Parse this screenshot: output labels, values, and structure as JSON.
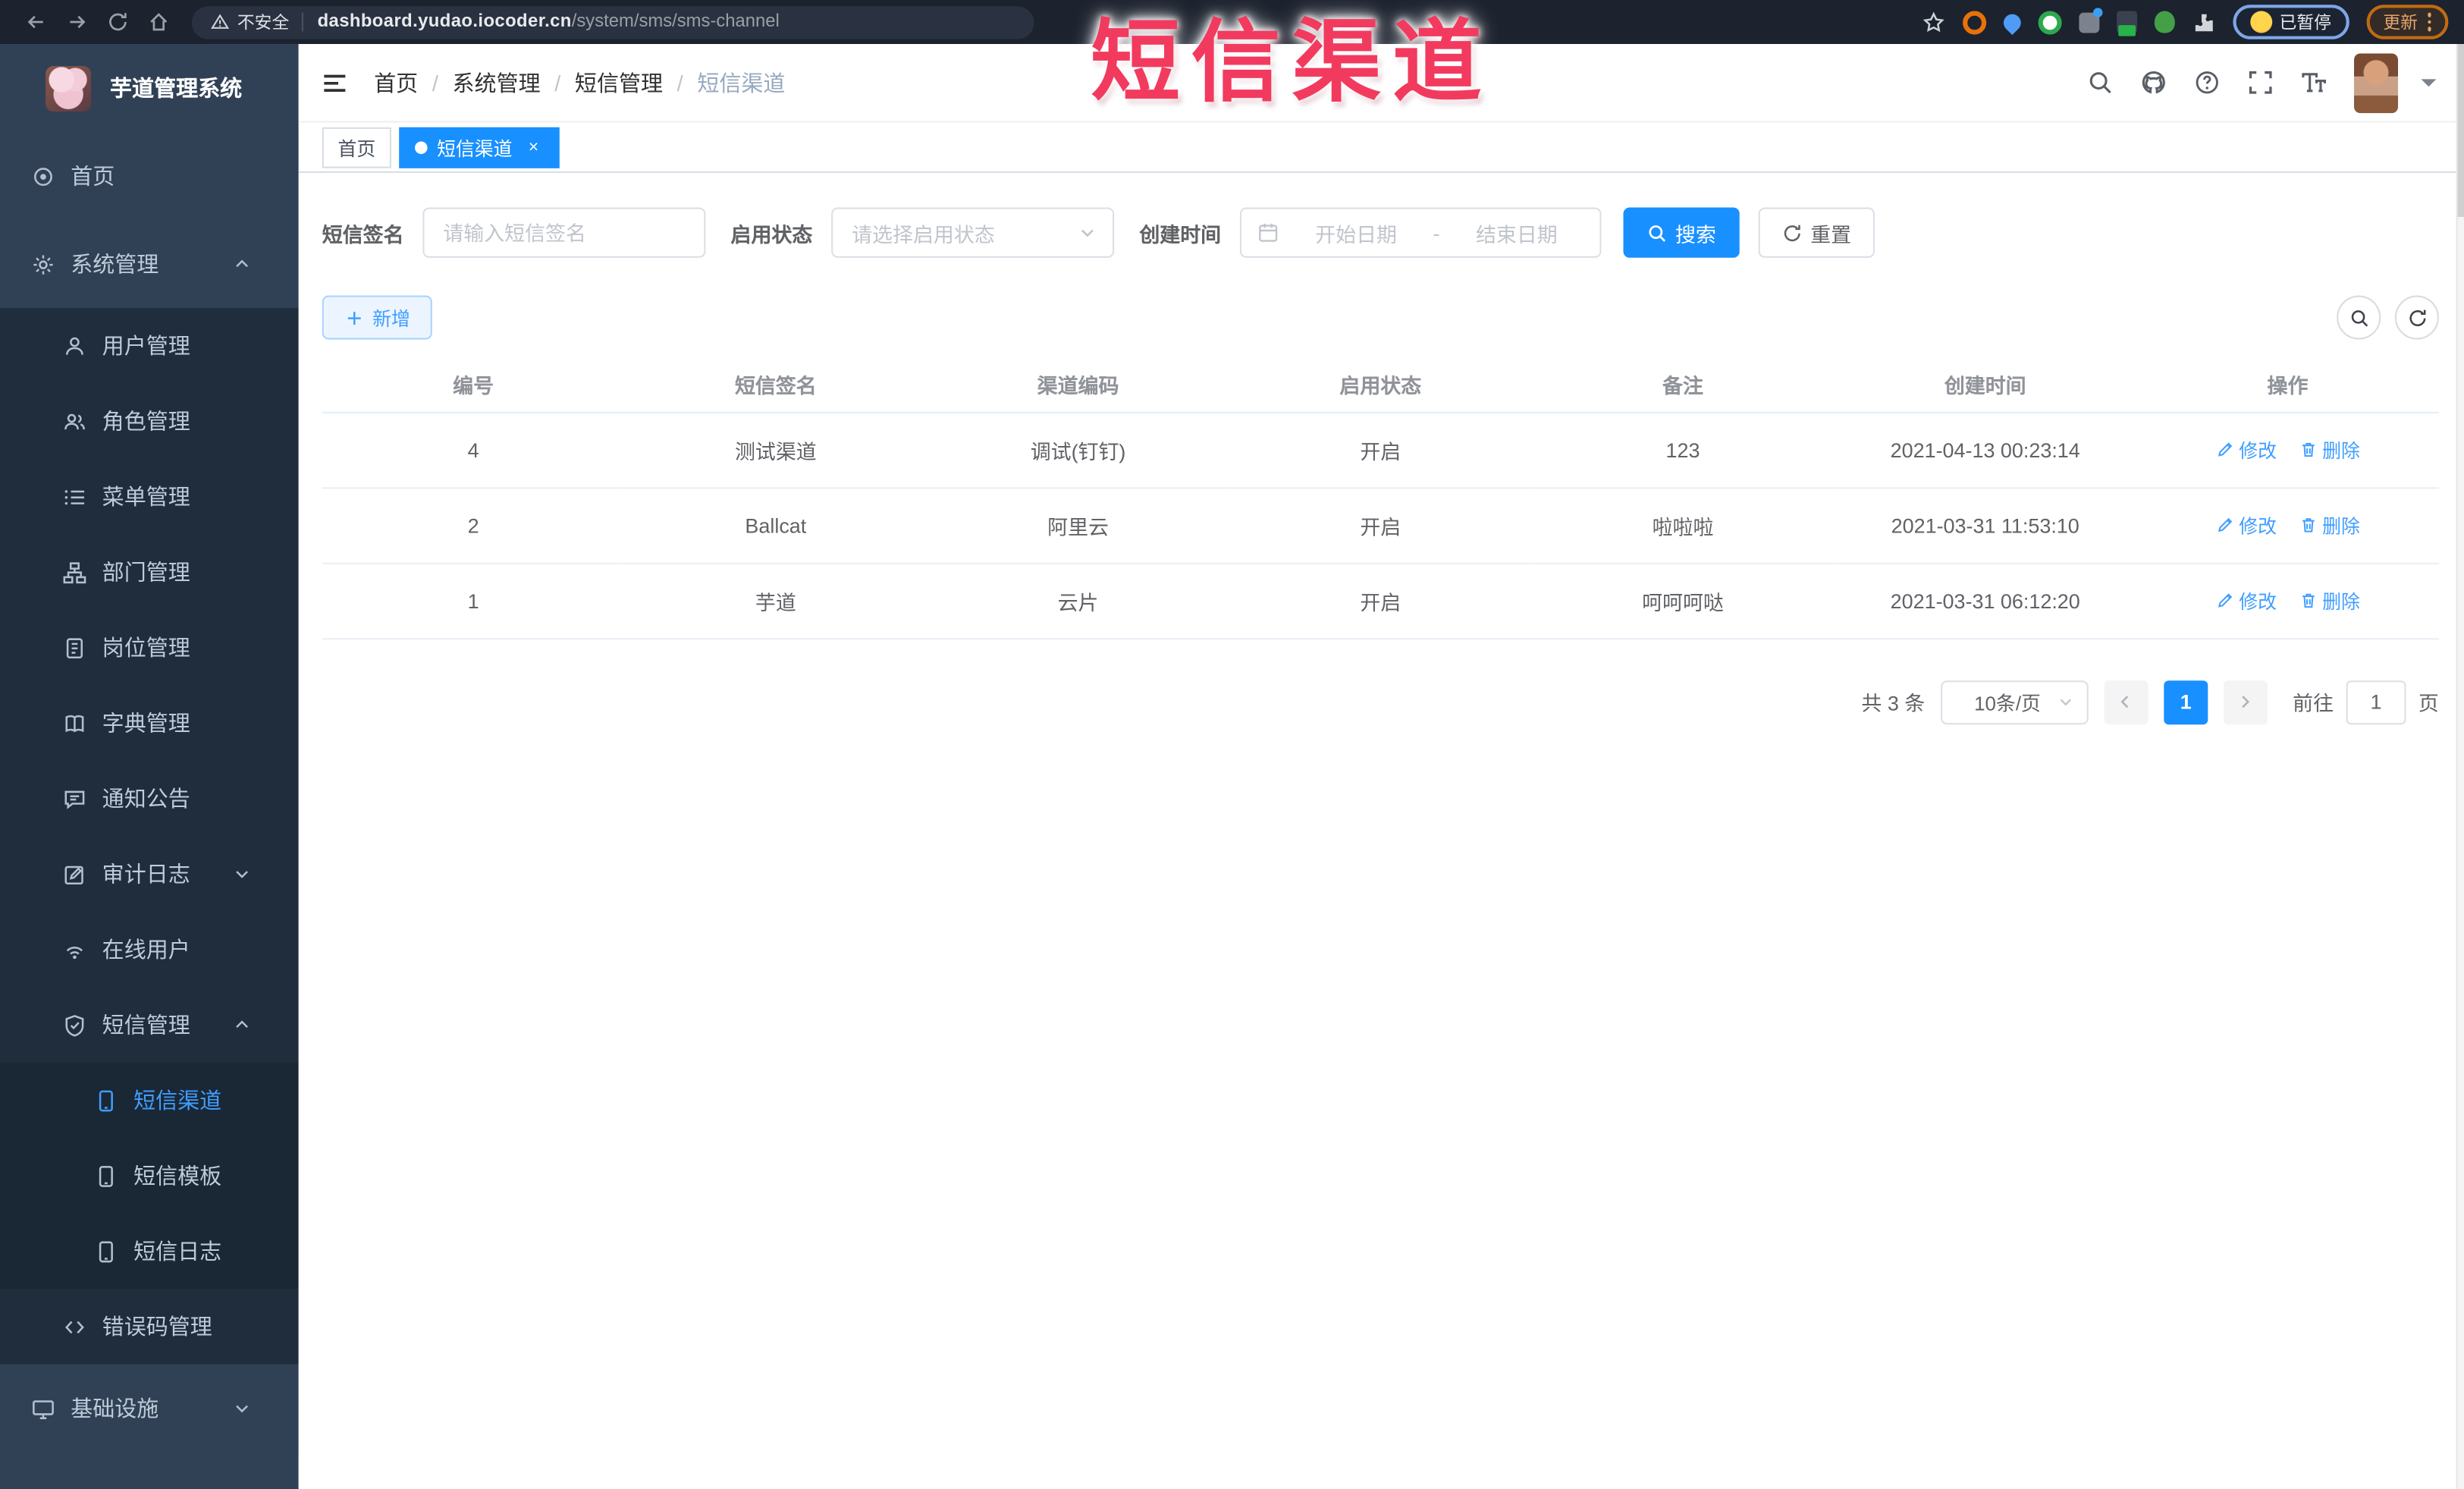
{
  "browser": {
    "security_label": "不安全",
    "url_host": "dashboard.yudao.iocoder.cn",
    "url_path": "/system/sms/sms-channel",
    "paused_label": "已暂停",
    "update_label": "更新"
  },
  "overlay": {
    "annotation": "短信渠道"
  },
  "sidebar": {
    "logo_title": "芋道管理系统",
    "menu": [
      {
        "label": "首页",
        "icon": "dashboard-icon",
        "level": 1
      },
      {
        "label": "系统管理",
        "icon": "gear-icon",
        "level": 1,
        "chevron": "up"
      },
      {
        "label": "用户管理",
        "icon": "user-icon",
        "level": 2
      },
      {
        "label": "角色管理",
        "icon": "users-icon",
        "level": 2
      },
      {
        "label": "菜单管理",
        "icon": "list-icon",
        "level": 2
      },
      {
        "label": "部门管理",
        "icon": "tree-icon",
        "level": 2
      },
      {
        "label": "岗位管理",
        "icon": "badge-icon",
        "level": 2
      },
      {
        "label": "字典管理",
        "icon": "book-icon",
        "level": 2
      },
      {
        "label": "通知公告",
        "icon": "chat-icon",
        "level": 2
      },
      {
        "label": "审计日志",
        "icon": "edit-icon",
        "level": 2,
        "chevron": "down"
      },
      {
        "label": "在线用户",
        "icon": "signal-icon",
        "level": 2
      },
      {
        "label": "短信管理",
        "icon": "shield-icon",
        "level": 2,
        "chevron": "up"
      },
      {
        "label": "短信渠道",
        "icon": "phone-icon",
        "level": 3,
        "active": true
      },
      {
        "label": "短信模板",
        "icon": "phone-icon",
        "level": 3
      },
      {
        "label": "短信日志",
        "icon": "phone-icon",
        "level": 3
      },
      {
        "label": "错误码管理",
        "icon": "code-icon",
        "level": 2
      },
      {
        "label": "基础设施",
        "icon": "monitor-icon",
        "level": 1,
        "chevron": "down"
      }
    ]
  },
  "navbar": {
    "breadcrumb": [
      "首页",
      "系统管理",
      "短信管理",
      "短信渠道"
    ]
  },
  "tabs": [
    {
      "label": "首页",
      "active": false
    },
    {
      "label": "短信渠道",
      "active": true,
      "closable": true
    }
  ],
  "filters": {
    "sign_label": "短信签名",
    "sign_placeholder": "请输入短信签名",
    "status_label": "启用状态",
    "status_placeholder": "请选择启用状态",
    "time_label": "创建时间",
    "start_placeholder": "开始日期",
    "range_separator": "-",
    "end_placeholder": "结束日期",
    "search_label": "搜索",
    "reset_label": "重置"
  },
  "toolbar": {
    "add_label": "新增"
  },
  "table": {
    "columns": [
      "编号",
      "短信签名",
      "渠道编码",
      "启用状态",
      "备注",
      "创建时间",
      "操作"
    ],
    "rows": [
      {
        "id": "4",
        "sign": "测试渠道",
        "code": "调试(钉钉)",
        "status": "开启",
        "remark": "123",
        "created": "2021-04-13 00:23:14"
      },
      {
        "id": "2",
        "sign": "Ballcat",
        "code": "阿里云",
        "status": "开启",
        "remark": "啦啦啦",
        "created": "2021-03-31 11:53:10"
      },
      {
        "id": "1",
        "sign": "芋道",
        "code": "云片",
        "status": "开启",
        "remark": "呵呵呵哒",
        "created": "2021-03-31 06:12:20"
      }
    ],
    "edit_label": "修改",
    "delete_label": "删除"
  },
  "pagination": {
    "total_label": "共 3 条",
    "page_size": "10条/页",
    "page": "1",
    "goto_label": "前往",
    "page_suffix": "页"
  },
  "colors": {
    "accent": "#1890ff",
    "link": "#409eff",
    "annotation": "#f23a5f",
    "sidebar_bg": "#304156",
    "submenu_bg": "#1f2d3d"
  }
}
